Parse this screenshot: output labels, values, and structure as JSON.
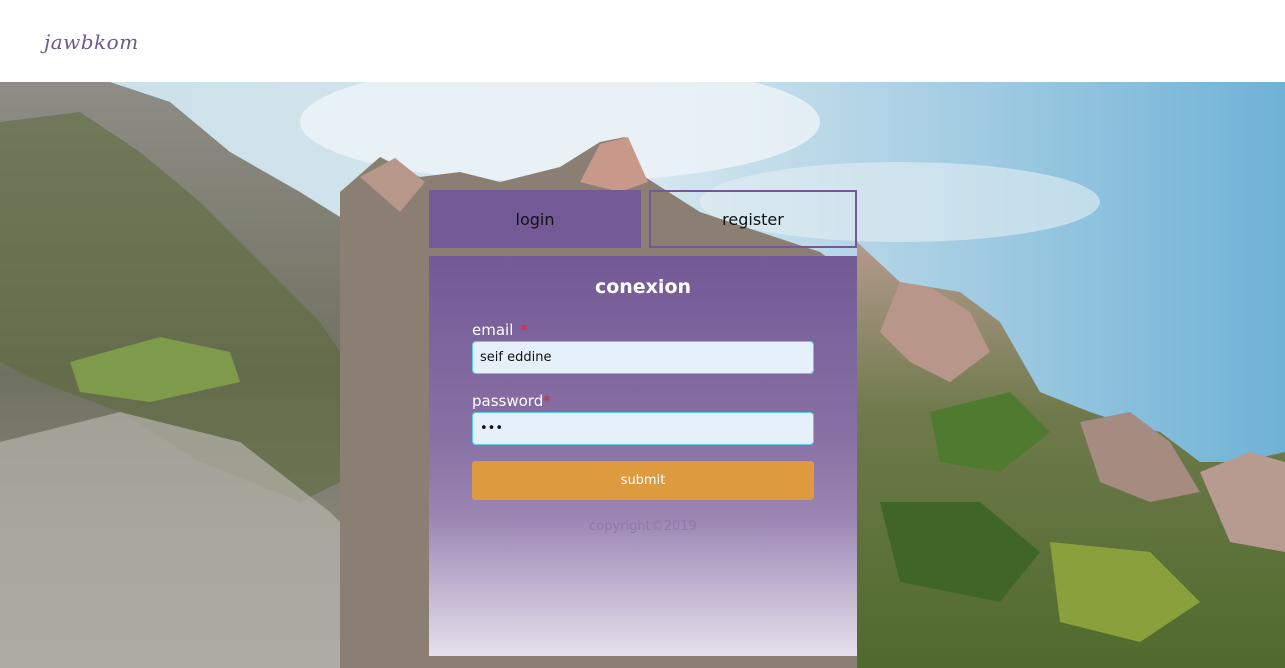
{
  "header": {
    "logo": "jawbkom"
  },
  "tabs": {
    "login": "login",
    "register": "register"
  },
  "form": {
    "title": "conexion",
    "email_label": "email",
    "email_value": "seif eddine",
    "password_label": "password",
    "password_value": "123",
    "required_mark": "*",
    "submit_label": "submit"
  },
  "footer": {
    "copyright": "copyright©2019"
  },
  "colors": {
    "accent": "#735a96",
    "submit": "#dd9a3e",
    "required": "#e8203a",
    "input_border": "#5ad0e4"
  }
}
